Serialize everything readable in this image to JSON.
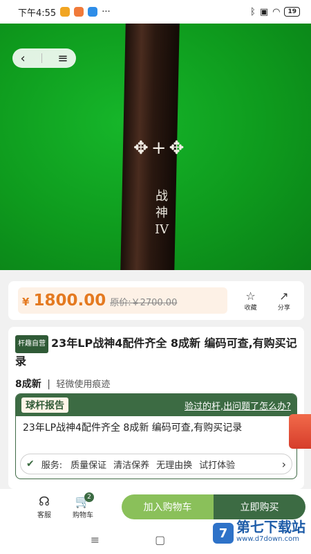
{
  "status_bar": {
    "time": "下午4:55",
    "more": "···",
    "battery": "19"
  },
  "hero": {
    "ornament": "✥+✥",
    "cue_text_line1": "战",
    "cue_text_line2": "神",
    "cue_text_line3": "IV",
    "back_icon": "‹",
    "menu_icon": "≡"
  },
  "price": {
    "currency": "¥",
    "value": "1800.00",
    "original": "原价:￥2700.00",
    "favorite_label": "收藏",
    "share_label": "分享"
  },
  "detail": {
    "tag": "杆趣自营",
    "title": "23年LP战神4配件齐全 8成新 编码可查,有购买记录",
    "condition_main": "8成新",
    "condition_sep": "|",
    "condition_desc": "轻微使用痕迹",
    "report": {
      "badge": "球杆报告",
      "link": "验过的杆,出问题了怎么办?",
      "text": "23年LP战神4配件齐全 8成新 编码可查,有购买记录"
    },
    "services": {
      "label": "服务:",
      "items": [
        "质量保证",
        "清洁保养",
        "无理由换",
        "试打体验"
      ]
    }
  },
  "bottom": {
    "service_label": "客服",
    "cart_label": "购物车",
    "cart_count": "2",
    "add_cart": "加入购物车",
    "buy_now": "立即购买"
  },
  "watermark": {
    "title": "第七下载站",
    "url": "www.d7down.com"
  }
}
